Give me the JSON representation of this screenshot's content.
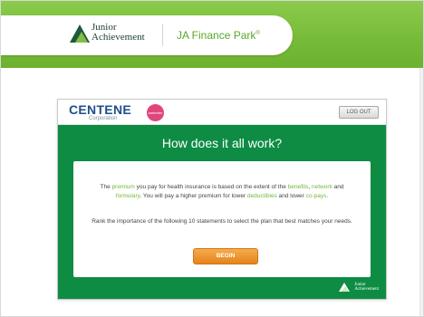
{
  "banner": {
    "org_line1": "Junior",
    "org_line2": "Achievement",
    "app_name": "JA Finance Park",
    "app_mark": "®"
  },
  "app": {
    "company": "CENTENE",
    "company_sub": "Corporation",
    "partner_badge": "ambetter",
    "logout_label": "LOG OUT",
    "title": "How does it all work?",
    "para1": {
      "t1": "The ",
      "premium": "premium",
      "t2": " you pay for health insurance is based on the extent of the ",
      "benefits": "benefits",
      "t3": ", ",
      "network": "network",
      "t4": " and ",
      "formulary": "formulary",
      "t5": ". You will pay a higher premium for lower ",
      "deductibles": "deductibles",
      "t6": " and lower ",
      "copays": "co-pays",
      "t7": "."
    },
    "para2": "Rank the importance of the following 10 statements to select the plan that best matches your needs.",
    "begin_label": "BEGIN",
    "footer_line1": "Junior",
    "footer_line2": "Achievement"
  },
  "colors": {
    "banner_green": "#78bb3a",
    "panel_green": "#0e8c43",
    "highlight_green": "#72b83b",
    "begin_orange": "#e5831b",
    "centene_blue": "#1f4f8a",
    "ambetter_pink": "#e0457b"
  },
  "icons": {
    "ja_logo": "junior-achievement-mountain-icon",
    "footer_logo": "junior-achievement-mountain-icon"
  }
}
